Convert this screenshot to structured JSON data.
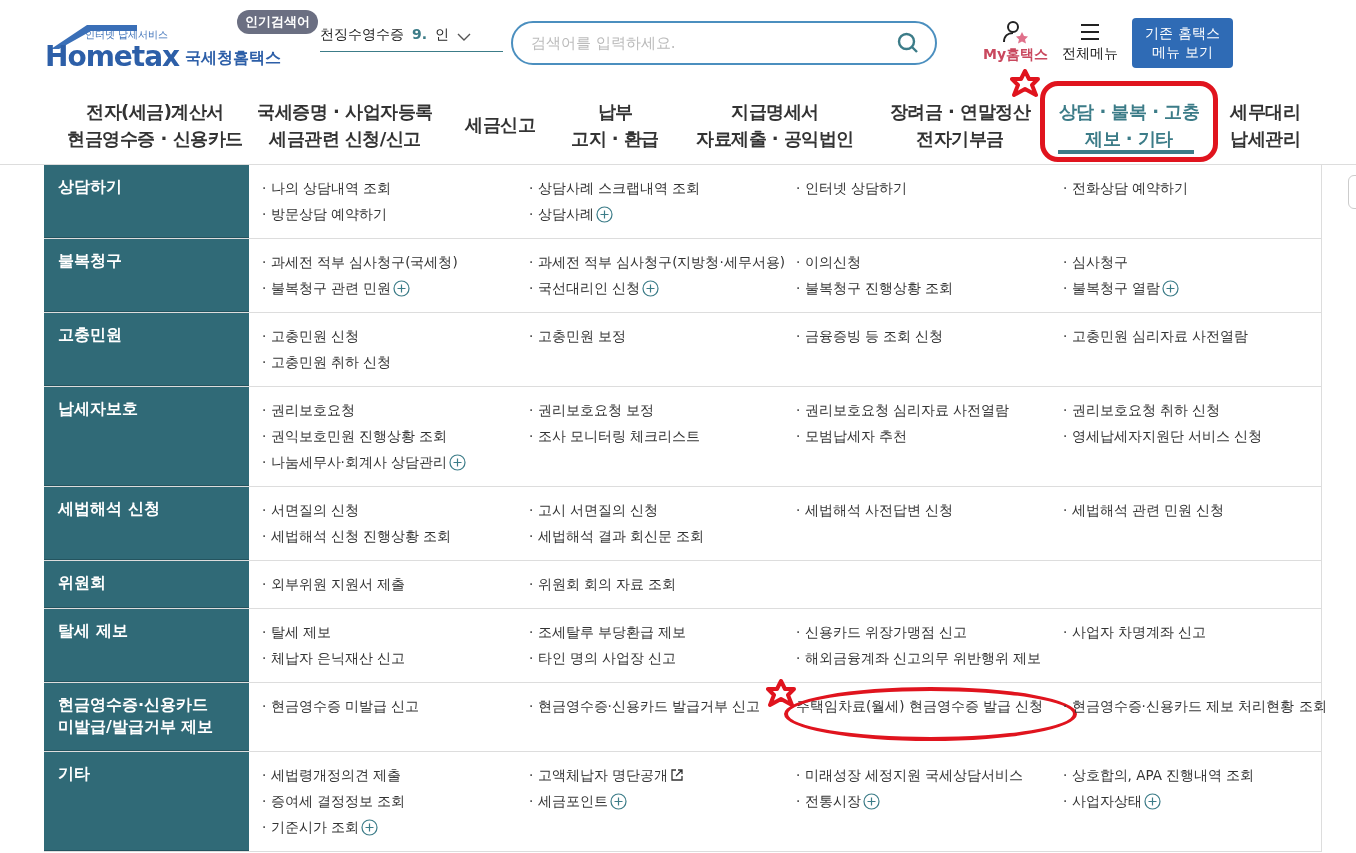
{
  "header": {
    "logo": {
      "tagline": "인터넷 납세서비스",
      "wordmark": "Hometax",
      "name": "국세청홈택스"
    },
    "popular": {
      "badge": "인기검색어",
      "current": "천징수영수증",
      "rank": "9.",
      "next": "인"
    },
    "search": {
      "placeholder": "검색어를 입력하세요."
    },
    "my": "My홈택스",
    "all_menu": "전체메뉴",
    "legacy_button": [
      "기존 홈택스",
      "메뉴 보기"
    ]
  },
  "nav": [
    {
      "lines": [
        "전자(세금)계산서",
        "현금영수증 · 신용카드"
      ],
      "selected": false,
      "annotated": false
    },
    {
      "lines": [
        "국세증명 · 사업자등록",
        "세금관련 신청/신고"
      ],
      "selected": false,
      "annotated": false
    },
    {
      "lines": [
        "세금신고"
      ],
      "selected": false,
      "annotated": false
    },
    {
      "lines": [
        "납부",
        "고지 · 환급"
      ],
      "selected": false,
      "annotated": false
    },
    {
      "lines": [
        "지급명세서",
        "자료제출 · 공익법인"
      ],
      "selected": false,
      "annotated": false
    },
    {
      "lines": [
        "장려금 · 연말정산",
        "전자기부금"
      ],
      "selected": false,
      "annotated": false
    },
    {
      "lines": [
        "상담 · 불복 · 고충",
        "제보 · 기타"
      ],
      "selected": true,
      "annotated": true
    },
    {
      "lines": [
        "세무대리",
        "납세관리"
      ],
      "selected": false,
      "annotated": false
    }
  ],
  "sections": [
    {
      "title": [
        "상담하기"
      ],
      "items": [
        {
          "text": "· 나의 상담내역 조회",
          "kind": "link"
        },
        {
          "text": "· 상담사례 스크랩내역 조회",
          "kind": "link"
        },
        {
          "text": "· 인터넷 상담하기",
          "kind": "link"
        },
        {
          "text": "· 전화상담 예약하기",
          "kind": "link"
        },
        {
          "text": "· 방문상담 예약하기",
          "kind": "link"
        },
        {
          "text": "· 상담사례",
          "kind": "expand"
        }
      ]
    },
    {
      "title": [
        "불복청구"
      ],
      "items": [
        {
          "text": "· 과세전 적부 심사청구(국세청)",
          "kind": "link"
        },
        {
          "text": "· 과세전 적부 심사청구(지방청·세무서용)",
          "kind": "link"
        },
        {
          "text": "· 이의신청",
          "kind": "link"
        },
        {
          "text": "· 심사청구",
          "kind": "link"
        },
        {
          "text": "· 불복청구 관련 민원",
          "kind": "expand"
        },
        {
          "text": "· 국선대리인 신청",
          "kind": "expand"
        },
        {
          "text": "· 불복청구 진행상황 조회",
          "kind": "link"
        },
        {
          "text": "· 불복청구 열람",
          "kind": "expand"
        }
      ]
    },
    {
      "title": [
        "고충민원"
      ],
      "items": [
        {
          "text": "· 고충민원 신청",
          "kind": "link"
        },
        {
          "text": "· 고충민원 보정",
          "kind": "link"
        },
        {
          "text": "· 금융증빙 등 조회 신청",
          "kind": "link"
        },
        {
          "text": "· 고충민원 심리자료 사전열람",
          "kind": "link"
        },
        {
          "text": "· 고충민원 취하 신청",
          "kind": "link"
        }
      ]
    },
    {
      "title": [
        "납세자보호"
      ],
      "items": [
        {
          "text": "· 권리보호요청",
          "kind": "link"
        },
        {
          "text": "· 권리보호요청 보정",
          "kind": "link"
        },
        {
          "text": "· 권리보호요청 심리자료 사전열람",
          "kind": "link"
        },
        {
          "text": "· 권리보호요청 취하 신청",
          "kind": "link"
        },
        {
          "text": "· 권익보호민원 진행상황 조회",
          "kind": "link"
        },
        {
          "text": "· 조사 모니터링 체크리스트",
          "kind": "link"
        },
        {
          "text": "· 모범납세자 추천",
          "kind": "link"
        },
        {
          "text": "· 영세납세자지원단 서비스 신청",
          "kind": "link"
        },
        {
          "text": "· 나눔세무사·회계사 상담관리",
          "kind": "expand"
        }
      ]
    },
    {
      "title": [
        "세법해석 신청"
      ],
      "items": [
        {
          "text": "· 서면질의 신청",
          "kind": "link"
        },
        {
          "text": "· 고시 서면질의 신청",
          "kind": "link"
        },
        {
          "text": "· 세법해석 사전답변 신청",
          "kind": "link"
        },
        {
          "text": "· 세법해석 관련 민원 신청",
          "kind": "link"
        },
        {
          "text": "· 세법해석 신청 진행상황 조회",
          "kind": "link"
        },
        {
          "text": "· 세법해석 결과 회신문 조회",
          "kind": "link"
        }
      ]
    },
    {
      "title": [
        "위원회"
      ],
      "items": [
        {
          "text": "· 외부위원 지원서 제출",
          "kind": "link"
        },
        {
          "text": "· 위원회 회의 자료 조회",
          "kind": "link"
        }
      ]
    },
    {
      "title": [
        "탈세 제보"
      ],
      "items": [
        {
          "text": "· 탈세 제보",
          "kind": "link"
        },
        {
          "text": "· 조세탈루 부당환급 제보",
          "kind": "link"
        },
        {
          "text": "· 신용카드 위장가맹점 신고",
          "kind": "link"
        },
        {
          "text": "· 사업자 차명계좌 신고",
          "kind": "link"
        },
        {
          "text": "· 체납자 은닉재산 신고",
          "kind": "link"
        },
        {
          "text": "· 타인 명의 사업장 신고",
          "kind": "link"
        },
        {
          "text": "· 해외금융계좌 신고의무 위반행위 제보",
          "kind": "link"
        }
      ]
    },
    {
      "title": [
        "현금영수증·신용카드",
        "미발급/발급거부 제보"
      ],
      "items": [
        {
          "text": "· 현금영수증 미발급 신고",
          "kind": "link"
        },
        {
          "text": "· 현금영수증·신용카드 발급거부 신고",
          "kind": "link"
        },
        {
          "text": "주택임차료(월세) 현금영수증 발급 신청",
          "kind": "link",
          "annotated": true
        },
        {
          "text": "· 현금영수증·신용카드 제보 처리현황 조회",
          "kind": "link"
        }
      ]
    },
    {
      "title": [
        "기타"
      ],
      "items": [
        {
          "text": "· 세법령개정의견 제출",
          "kind": "link"
        },
        {
          "text": "· 고액체납자 명단공개",
          "kind": "external"
        },
        {
          "text": "· 미래성장 세정지원 국세상담서비스",
          "kind": "link"
        },
        {
          "text": "· 상호합의, APA 진행내역 조회",
          "kind": "link"
        },
        {
          "text": "· 증여세 결정정보 조회",
          "kind": "link"
        },
        {
          "text": "· 세금포인트",
          "kind": "expand"
        },
        {
          "text": "· 전통시장",
          "kind": "expand"
        },
        {
          "text": "· 사업자상태",
          "kind": "expand"
        },
        {
          "text": "· 기준시가 조회",
          "kind": "expand"
        }
      ]
    }
  ]
}
